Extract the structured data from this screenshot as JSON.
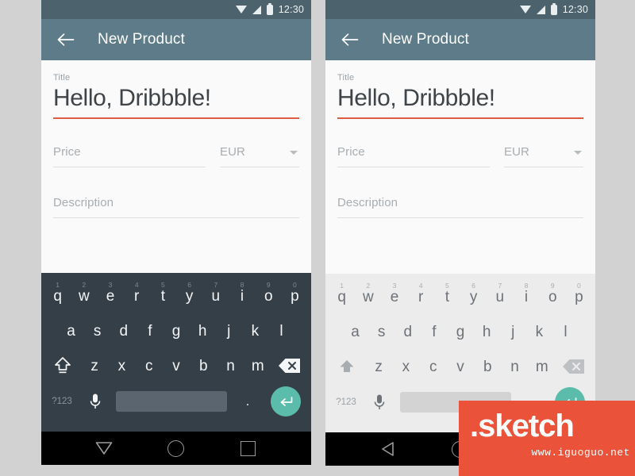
{
  "theme": {
    "statusbar_color": "#4c626c",
    "appbar_color": "#5d7b88",
    "form_bg": "#fafafa",
    "accent_underline": "#dd5b41",
    "enter_key_color": "#5cbcab",
    "keyboard_dark_bg": "#353f48",
    "keyboard_light_bg": "#ececec",
    "navbar_color": "#000000",
    "page_bg": "#d2d2d2",
    "watermark_color": "#ea5239"
  },
  "statusbar": {
    "time": "12:30",
    "icons": [
      "cast-icon",
      "signal-icon",
      "battery-icon"
    ]
  },
  "appbar": {
    "back_icon": "arrow-left-icon",
    "title": "New Product"
  },
  "form": {
    "title_field": {
      "label": "Title",
      "value": "Hello, Dribbble!",
      "state": "focused"
    },
    "price_field": {
      "placeholder": "Price",
      "value": ""
    },
    "currency_field": {
      "value": "EUR",
      "dropdown_icon": "chevron-down-icon"
    },
    "description_field": {
      "placeholder": "Description",
      "value": ""
    }
  },
  "keyboard": {
    "row1": [
      {
        "letter": "q",
        "num": "1"
      },
      {
        "letter": "w",
        "num": "2"
      },
      {
        "letter": "e",
        "num": "3"
      },
      {
        "letter": "r",
        "num": "4"
      },
      {
        "letter": "t",
        "num": "5"
      },
      {
        "letter": "y",
        "num": "6"
      },
      {
        "letter": "u",
        "num": "7"
      },
      {
        "letter": "i",
        "num": "8"
      },
      {
        "letter": "o",
        "num": "9"
      },
      {
        "letter": "p",
        "num": "0"
      }
    ],
    "row2": [
      "a",
      "s",
      "d",
      "f",
      "g",
      "h",
      "j",
      "k",
      "l"
    ],
    "row3": [
      "z",
      "x",
      "c",
      "v",
      "b",
      "n",
      "m"
    ],
    "shift_icon": "shift-arrow-icon",
    "backspace_icon": "backspace-icon",
    "symbols_key": "?123",
    "mic_icon": "microphone-icon",
    "space_key": "",
    "period_key": ".",
    "enter_icon": "enter-return-icon"
  },
  "navbar_left": {
    "back_icon": "triangle-down-back-icon",
    "home_icon": "circle-home-icon",
    "recents_icon": "square-recents-icon"
  },
  "navbar_right": {
    "back_icon": "triangle-left-back-icon",
    "home_icon": "circle-home-icon",
    "recents_icon": "square-recents-icon"
  },
  "watermark": {
    "main": ".sketch",
    "sub": "www.iguoguo.net"
  }
}
